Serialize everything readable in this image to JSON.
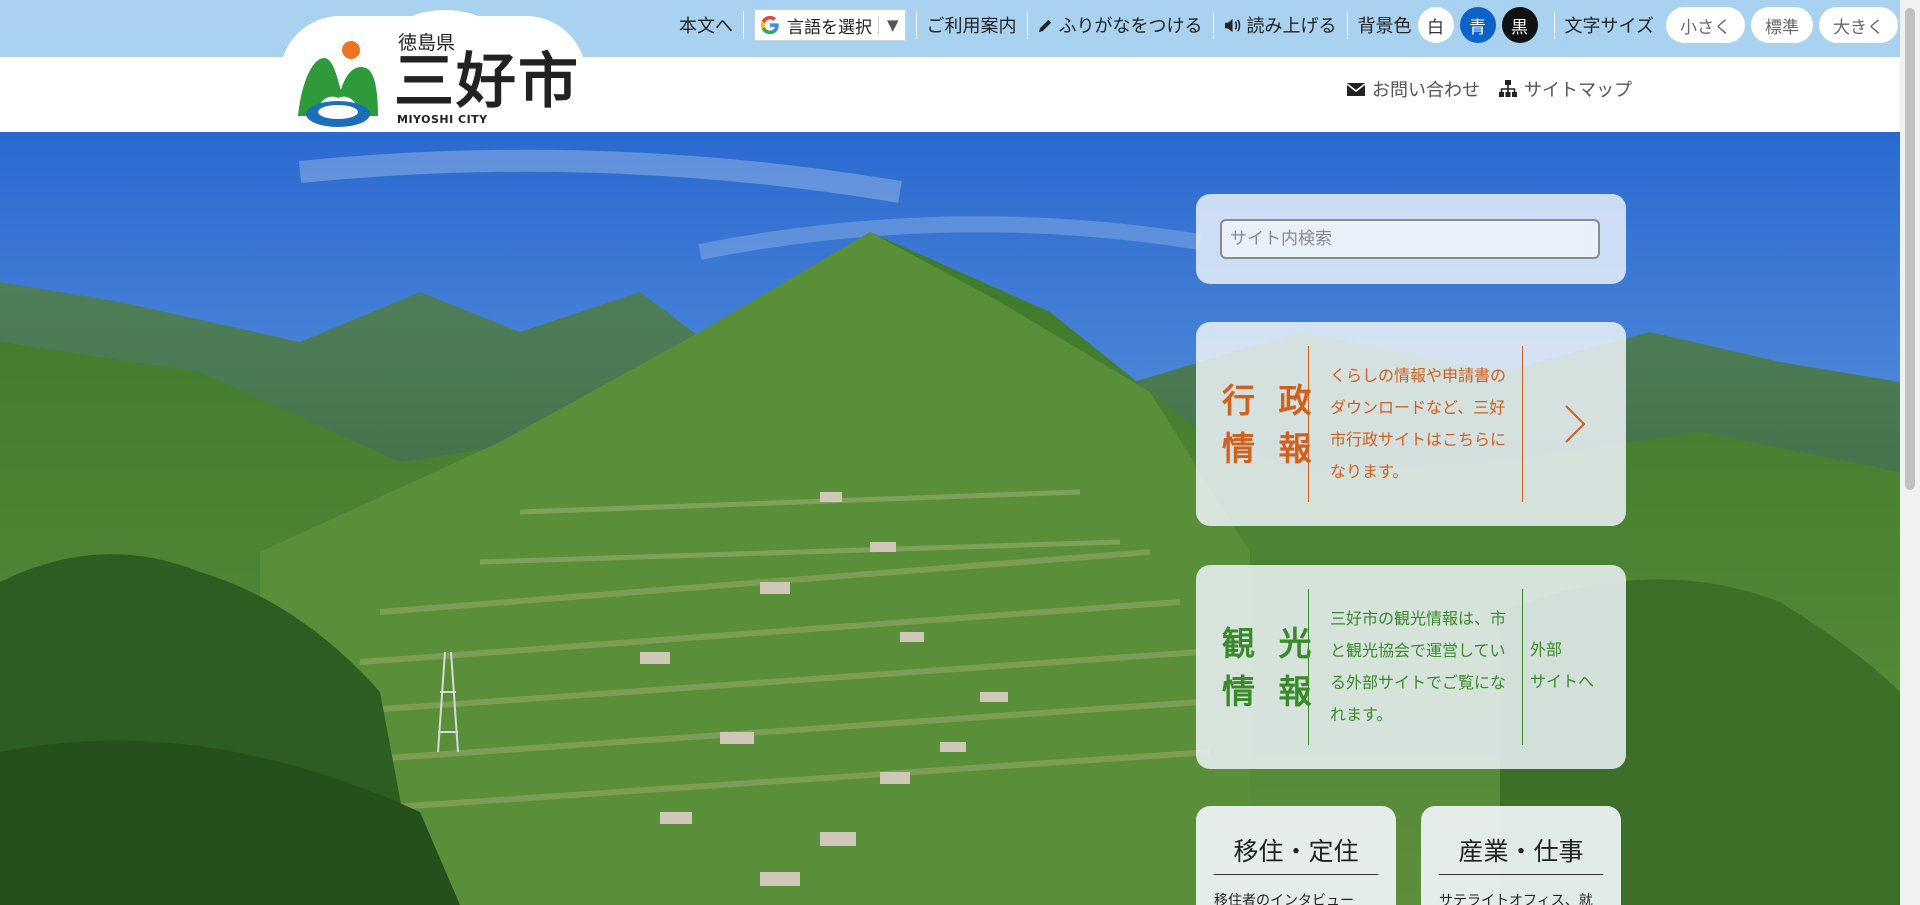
{
  "header": {
    "logo": {
      "prefecture": "徳島県",
      "city": "三好市",
      "english": "MIYOSHI CITY"
    },
    "topnav": {
      "skip_label": "本文へ",
      "translate_label": "言語を選択",
      "guide_label": "ご利用案内",
      "furigana_label": "ふりがなをつける",
      "read_aloud_label": "読み上げる",
      "bg_color_label": "背景色",
      "bg_white": "白",
      "bg_blue": "青",
      "bg_black": "黒",
      "font_size_label": "文字サイズ",
      "font_small": "小さく",
      "font_normal": "標準",
      "font_large": "大きく"
    },
    "subnav": {
      "contact_label": "お問い合わせ",
      "sitemap_label": "サイトマップ"
    }
  },
  "hero": {
    "search": {
      "placeholder": "サイト内検索"
    },
    "cards": [
      {
        "title_line1": "行 政",
        "title_line2": "情 報",
        "description": "くらしの情報や申請書のダウンロードなど、三好市行政サイトはこちらになります。"
      },
      {
        "title_line1": "観 光",
        "title_line2": "情 報",
        "description": "三好市の観光情報は、市と観光協会で運営している外部サイトでご覧になれます。",
        "external_label_1": "外部",
        "external_label_2": "サイトへ"
      }
    ],
    "small_cards": [
      {
        "title": "移住・定住",
        "subtitle": "移住者のインタビュー"
      },
      {
        "title": "産業・仕事",
        "subtitle": "サテライトオフィス、就"
      }
    ]
  },
  "colors": {
    "topbar": "#a9d1f0",
    "admin_accent": "#d0601e",
    "tourism_accent": "#3a8a2c",
    "bg_blue": "#0a63c9"
  }
}
